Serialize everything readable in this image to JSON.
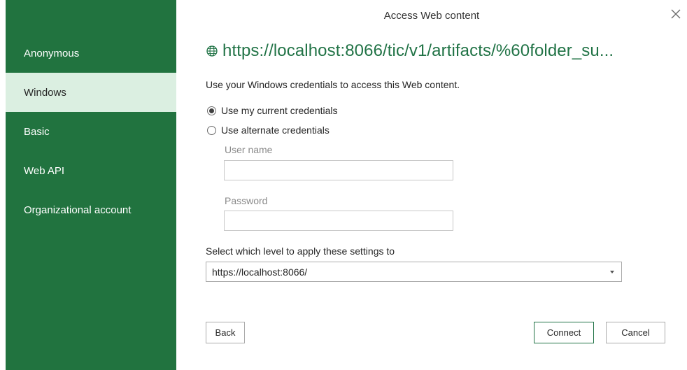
{
  "dialog": {
    "title": "Access Web content"
  },
  "sidebar": {
    "items": [
      {
        "label": "Anonymous",
        "selected": false
      },
      {
        "label": "Windows",
        "selected": true
      },
      {
        "label": "Basic",
        "selected": false
      },
      {
        "label": "Web API",
        "selected": false
      },
      {
        "label": "Organizational account",
        "selected": false
      }
    ]
  },
  "main": {
    "url": "https://localhost:8066/tic/v1/artifacts/%60folder_su...",
    "description": "Use your Windows credentials to access this Web content.",
    "options": [
      {
        "label": "Use my current credentials",
        "checked": true
      },
      {
        "label": "Use alternate credentials",
        "checked": false
      }
    ],
    "username": {
      "label": "User name",
      "value": ""
    },
    "password": {
      "label": "Password",
      "value": ""
    },
    "level": {
      "label": "Select which level to apply these settings to",
      "selected": "https://localhost:8066/"
    }
  },
  "buttons": {
    "back": "Back",
    "connect": "Connect",
    "cancel": "Cancel"
  },
  "colors": {
    "sidebar": "#21733f",
    "selected_item": "#dbefe1",
    "accent": "#217346"
  },
  "icons": {
    "close": "close-icon",
    "url": "globe-icon",
    "dropdown": "chevron-down-icon"
  }
}
